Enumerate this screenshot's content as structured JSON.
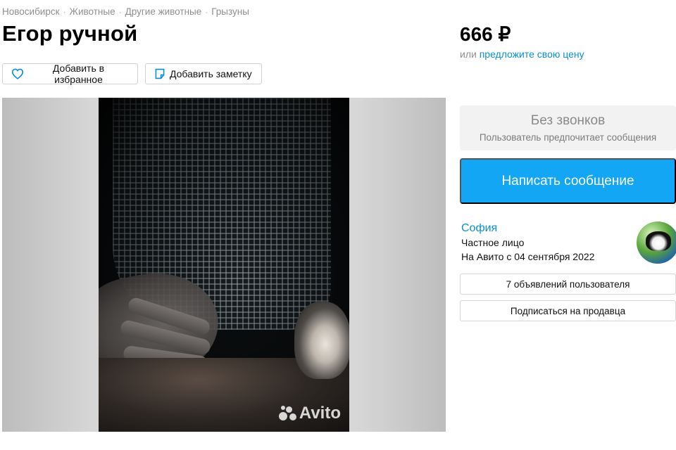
{
  "breadcrumbs": [
    "Новосибирск",
    "Животные",
    "Другие животные",
    "Грызуны"
  ],
  "title": "Егор ручной",
  "price": "666 ₽",
  "offer": {
    "prefix": "или",
    "link": "предложите свою цену"
  },
  "actions": {
    "favorite_label": "Добавить в избранное",
    "note_label": "Добавить заметку"
  },
  "gallery": {
    "watermark": "Avito"
  },
  "contact": {
    "no_calls_title": "Без звонков",
    "no_calls_sub": "Пользователь предпочитает сообщения",
    "message_button": "Написать сообщение"
  },
  "seller": {
    "name": "София",
    "type": "Частное лицо",
    "since": "На Авито с 04 сентября 2022",
    "ads_button": "7 объявлений пользователя",
    "subscribe_button": "Подписаться на продавца"
  },
  "colors": {
    "link": "#0a8fd6",
    "primary_button": "#13a6f4",
    "muted_text": "#8f8f8f"
  },
  "icons": {
    "favorite": "heart-icon",
    "note": "note-icon",
    "watermark": "avito-logo-icon"
  }
}
